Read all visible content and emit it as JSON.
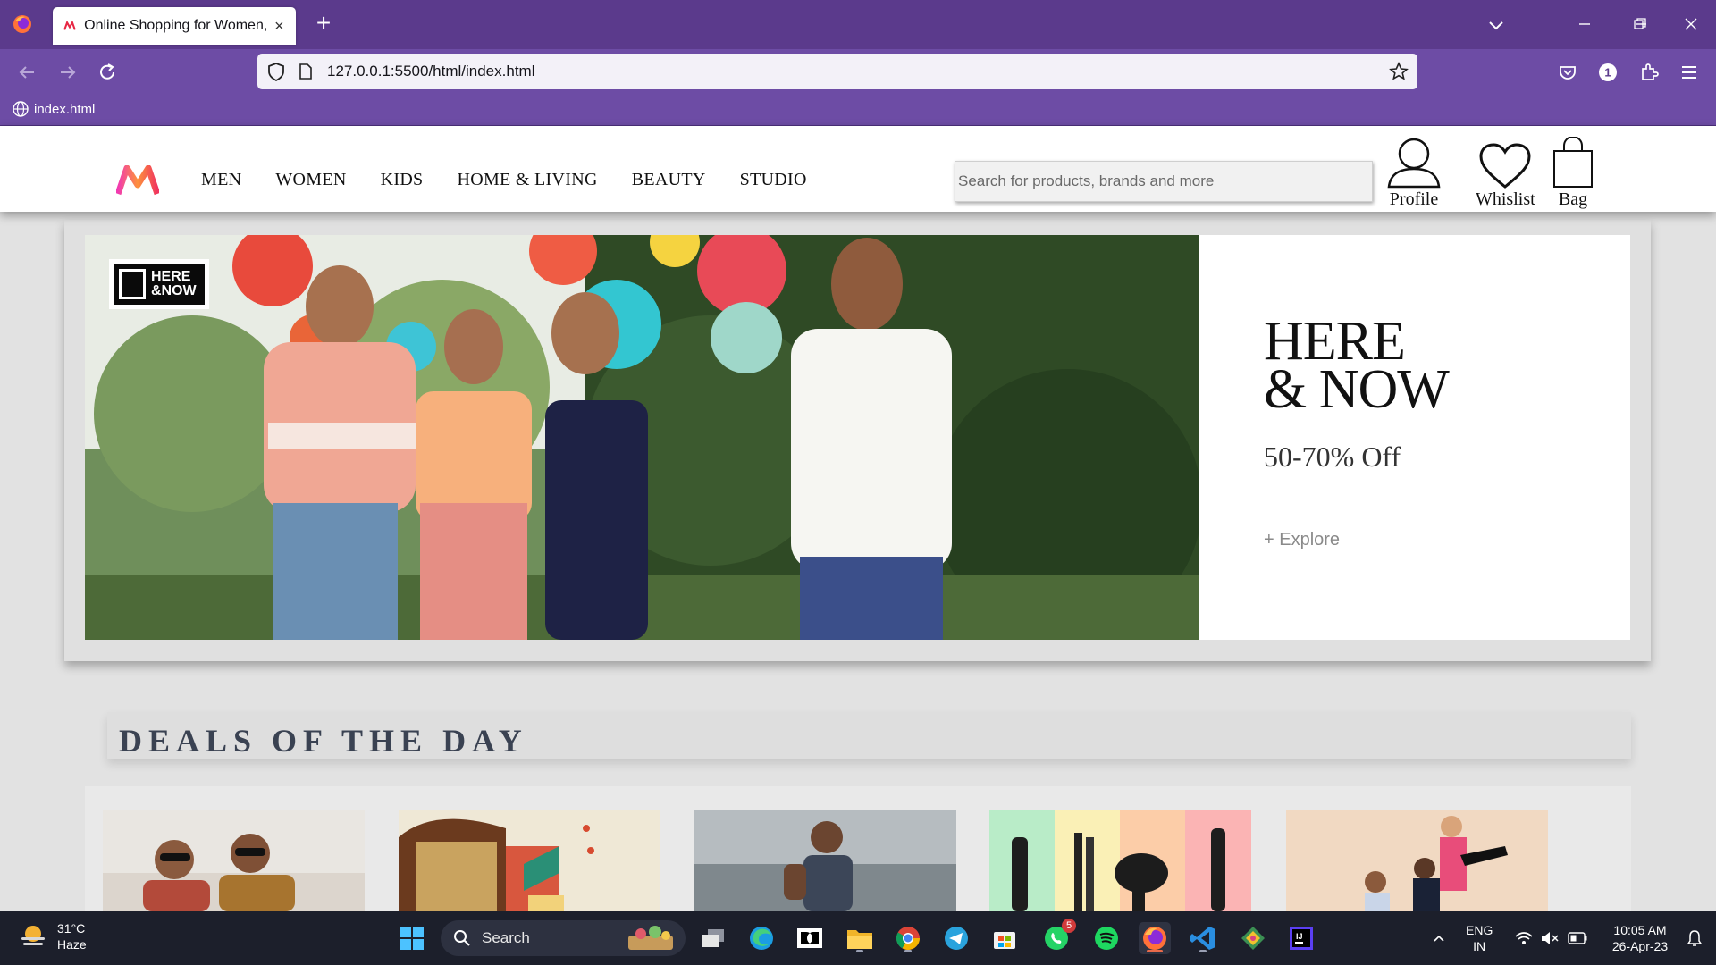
{
  "browser": {
    "tab_title": "Online Shopping for Women, M",
    "url": "127.0.0.1:5500/html/index.html",
    "bookmark": "index.html"
  },
  "site": {
    "brand_color": "#ff3f6c",
    "menu": [
      "MEN",
      "WOMEN",
      "KIDS",
      "HOME & LIVING",
      "BEAUTY",
      "STUDIO"
    ],
    "search_placeholder": "Search for products, brands and more",
    "actions": {
      "profile": "Profile",
      "wishlist": "Whislist",
      "bag": "Bag"
    }
  },
  "banner": {
    "badge_line1": "HERE",
    "badge_line2": "&NOW",
    "title_line1": "HERE",
    "title_line2": "& NOW",
    "offer": "50-70% Off",
    "cta": "+ Explore"
  },
  "deals": {
    "title": "DEALS OF THE DAY"
  },
  "taskbar": {
    "weather_temp": "31°C",
    "weather_desc": "Haze",
    "search": "Search",
    "whatsapp_badge": "5",
    "lang": "ENG",
    "region": "IN",
    "time": "10:05 AM",
    "date": "26-Apr-23"
  }
}
